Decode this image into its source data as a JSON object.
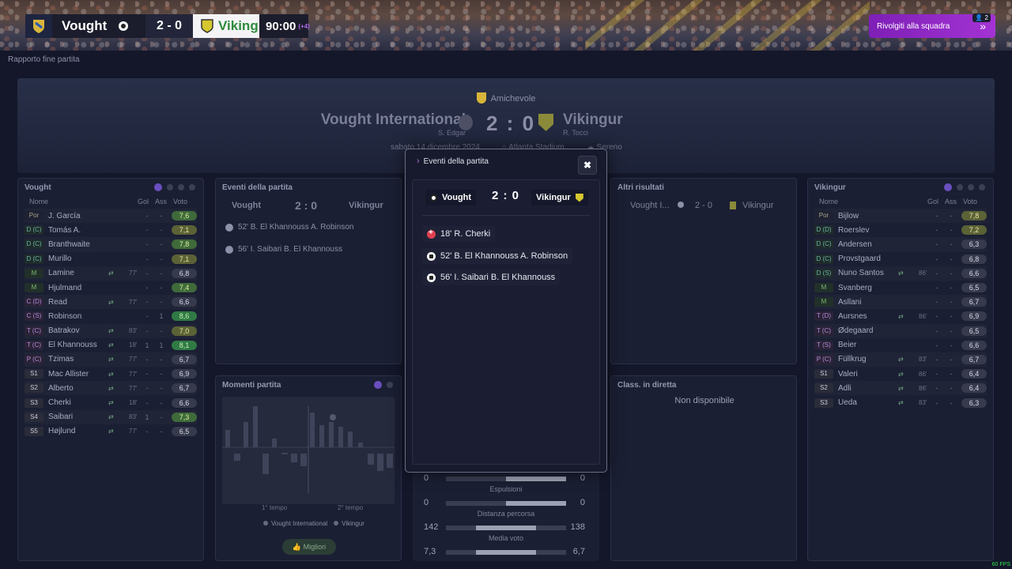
{
  "scorebar": {
    "home": "Vought",
    "score": "2 - 0",
    "away": "Viking",
    "time": "90:00",
    "stoppage": "(+4)"
  },
  "talk_button": {
    "label": "Rivolgiti alla squadra",
    "badge": "2"
  },
  "breadcrumb": "Rapporto fine partita",
  "match": {
    "competition": "Amichevole",
    "home": "Vought International",
    "home_coach": "S. Edgar",
    "away": "Vikingur",
    "away_coach": "R. Tocci",
    "score": "2 : 0",
    "date": "sabato 14 dicembre 2024",
    "stadium": "Atlanta Stadium",
    "weather": "Sereno"
  },
  "columns": {
    "name": "Nome",
    "gol": "Gol",
    "ass": "Ass",
    "vote": "Voto"
  },
  "home_panel": {
    "title": "Vought",
    "players": [
      {
        "pos": "Por",
        "name": "J. García",
        "gol": "-",
        "ass": "-",
        "vote": "7,6",
        "pc": "gk",
        "vc": "good"
      },
      {
        "pos": "D (C)",
        "name": "Tomás A.",
        "gol": "-",
        "ass": "-",
        "vote": "7,1",
        "pc": "def",
        "vc": "avg"
      },
      {
        "pos": "D (C)",
        "name": "Branthwaite",
        "gol": "-",
        "ass": "-",
        "vote": "7,8",
        "pc": "def",
        "vc": "good"
      },
      {
        "pos": "D (C)",
        "name": "Murillo",
        "gol": "-",
        "ass": "-",
        "vote": "7,1",
        "pc": "def",
        "vc": "avg"
      },
      {
        "pos": "M",
        "name": "Lamine",
        "sub": "77'",
        "gol": "-",
        "ass": "-",
        "vote": "6,8",
        "pc": "mid",
        "vc": ""
      },
      {
        "pos": "M",
        "name": "Hjulmand",
        "gol": "-",
        "ass": "-",
        "vote": "7,4",
        "pc": "mid",
        "vc": "good"
      },
      {
        "pos": "C (D)",
        "name": "Read",
        "sub": "77'",
        "gol": "-",
        "ass": "-",
        "vote": "6,6",
        "pc": "att",
        "vc": ""
      },
      {
        "pos": "C (S)",
        "name": "Robinson",
        "gol": "-",
        "ass": "1",
        "vote": "8,6",
        "pc": "att",
        "vc": "vgood"
      },
      {
        "pos": "T (C)",
        "name": "Batrakov",
        "sub": "83'",
        "gol": "-",
        "ass": "-",
        "vote": "7,0",
        "pc": "att",
        "vc": "avg"
      },
      {
        "pos": "T (C)",
        "name": "El Khannouss",
        "sub": "18'",
        "gol": "1",
        "ass": "1",
        "vote": "8,1",
        "pc": "att",
        "vc": "vgood"
      },
      {
        "pos": "P (C)",
        "name": "Tzimas",
        "sub": "77'",
        "gol": "-",
        "ass": "-",
        "vote": "6,7",
        "pc": "att",
        "vc": ""
      },
      {
        "pos": "S1",
        "name": "Mac Allister",
        "sub": "77'",
        "gol": "-",
        "ass": "-",
        "vote": "6,9",
        "pc": "sub",
        "vc": ""
      },
      {
        "pos": "S2",
        "name": "Alberto",
        "sub": "77'",
        "gol": "-",
        "ass": "-",
        "vote": "6,7",
        "pc": "sub",
        "vc": ""
      },
      {
        "pos": "S3",
        "name": "Cherki",
        "sub": "18'",
        "gol": "-",
        "ass": "-",
        "vote": "6,6",
        "pc": "sub",
        "vc": ""
      },
      {
        "pos": "S4",
        "name": "Saibari",
        "sub": "83'",
        "gol": "1",
        "ass": "-",
        "vote": "7,3",
        "pc": "sub",
        "vc": "good"
      },
      {
        "pos": "S5",
        "name": "Højlund",
        "sub": "77'",
        "gol": "-",
        "ass": "-",
        "vote": "6,5",
        "pc": "sub",
        "vc": ""
      }
    ]
  },
  "away_panel": {
    "title": "Vikingur",
    "players": [
      {
        "pos": "Por",
        "name": "Bijlow",
        "gol": "-",
        "ass": "-",
        "vote": "7,8",
        "pc": "gk",
        "vc": "avg"
      },
      {
        "pos": "D (D)",
        "name": "Roerslev",
        "gol": "-",
        "ass": "-",
        "vote": "7,2",
        "pc": "def",
        "vc": "avg"
      },
      {
        "pos": "D (C)",
        "name": "Andersen",
        "gol": "-",
        "ass": "-",
        "vote": "6,3",
        "pc": "def",
        "vc": ""
      },
      {
        "pos": "D (C)",
        "name": "Provstgaard",
        "gol": "-",
        "ass": "-",
        "vote": "6,8",
        "pc": "def",
        "vc": ""
      },
      {
        "pos": "D (S)",
        "name": "Nuno Santos",
        "sub": "86'",
        "gol": "-",
        "ass": "-",
        "vote": "6,6",
        "pc": "def",
        "vc": ""
      },
      {
        "pos": "M",
        "name": "Svanberg",
        "gol": "-",
        "ass": "-",
        "vote": "6,5",
        "pc": "mid",
        "vc": ""
      },
      {
        "pos": "M",
        "name": "Asllani",
        "gol": "-",
        "ass": "-",
        "vote": "6,7",
        "pc": "mid",
        "vc": ""
      },
      {
        "pos": "T (D)",
        "name": "Aursnes",
        "sub": "86'",
        "gol": "-",
        "ass": "-",
        "vote": "6,9",
        "pc": "att",
        "vc": ""
      },
      {
        "pos": "T (C)",
        "name": "Ødegaard",
        "gol": "-",
        "ass": "-",
        "vote": "6,5",
        "pc": "att",
        "vc": ""
      },
      {
        "pos": "T (S)",
        "name": "Beier",
        "gol": "-",
        "ass": "-",
        "vote": "6,6",
        "pc": "att",
        "vc": ""
      },
      {
        "pos": "P (C)",
        "name": "Füllkrug",
        "sub": "83'",
        "gol": "-",
        "ass": "-",
        "vote": "6,7",
        "pc": "att",
        "vc": ""
      },
      {
        "pos": "S1",
        "name": "Valeri",
        "sub": "86'",
        "gol": "-",
        "ass": "-",
        "vote": "6,4",
        "pc": "sub",
        "vc": ""
      },
      {
        "pos": "S2",
        "name": "Adli",
        "sub": "86'",
        "gol": "-",
        "ass": "-",
        "vote": "6,4",
        "pc": "sub",
        "vc": ""
      },
      {
        "pos": "S3",
        "name": "Ueda",
        "sub": "83'",
        "gol": "-",
        "ass": "-",
        "vote": "6,3",
        "pc": "sub",
        "vc": ""
      }
    ]
  },
  "events_panel": {
    "title": "Eventi della partita",
    "home": "Vought",
    "score": "2 : 0",
    "away": "Vikingur",
    "items": [
      "52' B. El Khannouss A. Robinson",
      "56' I. Saibari B. El Khannouss"
    ]
  },
  "other_results": {
    "title": "Altri risultati",
    "home": "Vought I...",
    "score": "2 - 0",
    "away": "Vikingur"
  },
  "live_table": {
    "title": "Class. in diretta",
    "message": "Non disponibile"
  },
  "moments": {
    "title": "Momenti partita",
    "half1": "1° tempo",
    "half2": "2° tempo",
    "legend_home": "Vought International",
    "legend_away": "Vikingur",
    "best_button": "Migliori"
  },
  "stats": [
    {
      "label": "",
      "home": "0",
      "away": "0",
      "home_share": 0.0,
      "away_share": 1.0
    },
    {
      "label": "Espulsioni",
      "home": "0",
      "away": "0",
      "home_share": 0.0,
      "away_share": 1.0
    },
    {
      "label": "Distanza percorsa",
      "home": "142",
      "away": "138",
      "home_share": 0.5,
      "away_share": 0.5
    },
    {
      "label": "Media voto",
      "home": "7,3",
      "away": "6,7",
      "home_share": 0.5,
      "away_share": 0.5
    }
  ],
  "overlay": {
    "title": "Eventi della partita",
    "close": "✖",
    "home": "Vought",
    "score": "2 : 0",
    "away": "Vikingur",
    "events": [
      {
        "type": "injury",
        "text": "18' R. Cherki"
      },
      {
        "type": "goal",
        "text": "52' B. El Khannouss A. Robinson"
      },
      {
        "type": "goal",
        "text": "56' I. Saibari B. El Khannouss"
      }
    ]
  },
  "fps": "60 FPS"
}
